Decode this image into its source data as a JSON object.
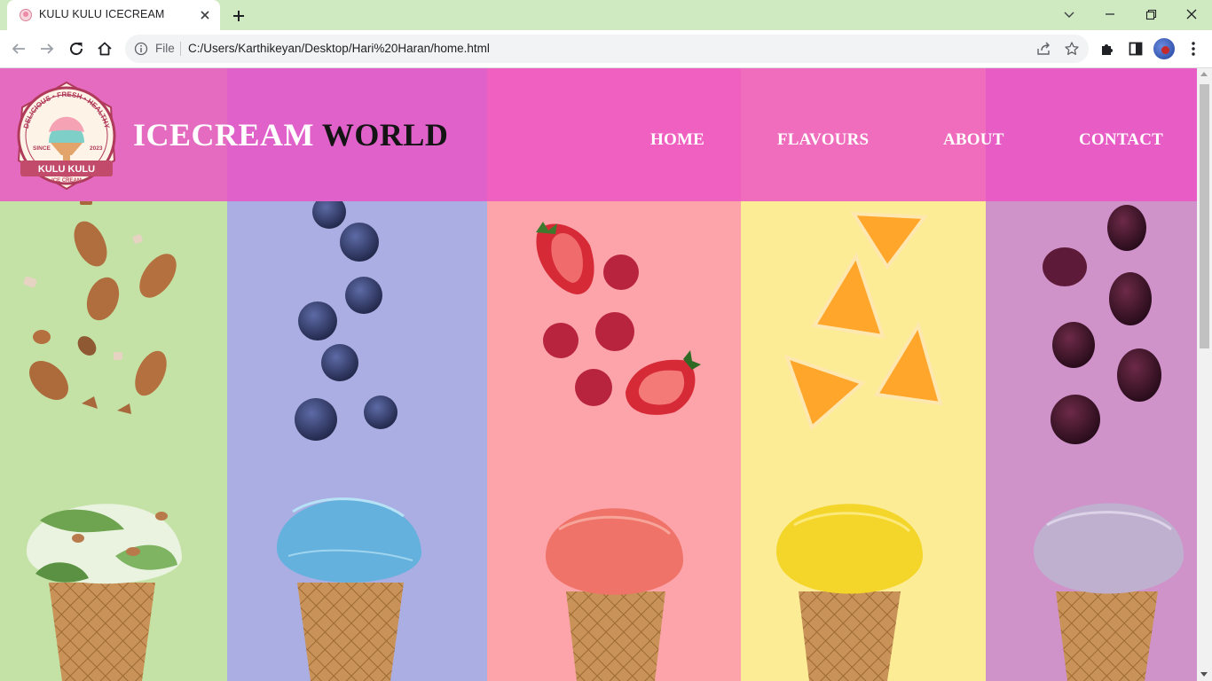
{
  "browser": {
    "tab_title": "KULU KULU ICECREAM",
    "url_scheme": "File",
    "url": "C:/Users/Karthikeyan/Desktop/Hari%20Haran/home.html"
  },
  "site": {
    "logo": {
      "arc_text": "DELICIOUS • FRESH • HEALTHY",
      "since": "SINCE",
      "year": "2023",
      "brand": "KULU KULU",
      "sub": "ICE CREAM"
    },
    "title_part1": "ICECREAM",
    "title_part2": "WORLD",
    "nav": [
      "HOME",
      "FLAVOURS",
      "ABOUT",
      "CONTACT"
    ]
  },
  "panels": [
    {
      "fruit": "almonds",
      "icon": "almond-icon",
      "color": "#c4e2a6"
    },
    {
      "fruit": "blueberries",
      "icon": "blueberry-icon",
      "color": "#aaaee2"
    },
    {
      "fruit": "strawberries and raspberries",
      "icon": "strawberry-icon",
      "color": "#fda4ab"
    },
    {
      "fruit": "orange slices",
      "icon": "orange-slice-icon",
      "color": "#fcec96"
    },
    {
      "fruit": "blackberries",
      "icon": "blackberry-icon",
      "color": "#cf92c9"
    }
  ],
  "colors": {
    "header_overlay": "#ec50c4",
    "chrome_tabstrip": "#cfe9c0"
  }
}
